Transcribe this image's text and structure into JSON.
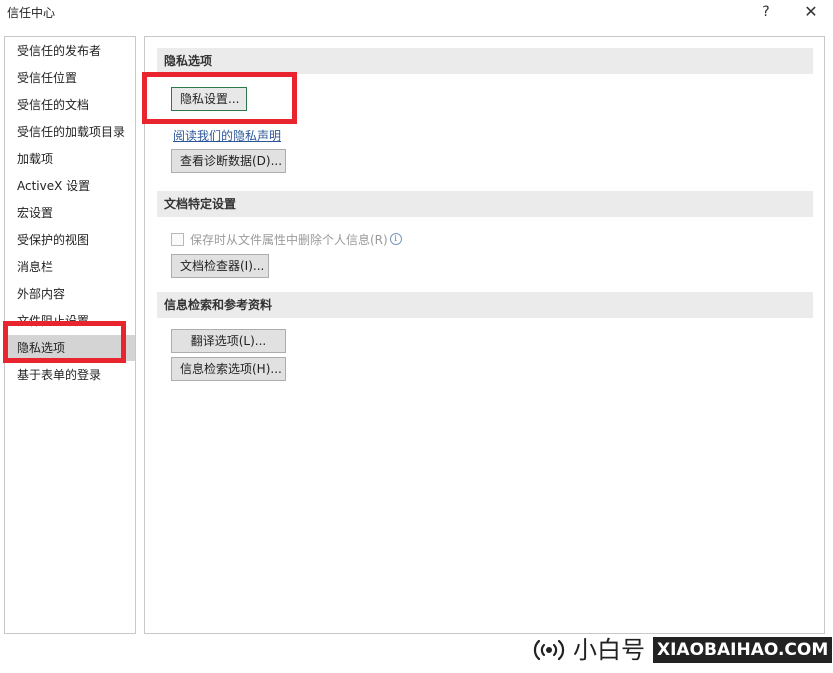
{
  "window": {
    "title": "信任中心",
    "help_glyph": "?",
    "close_glyph": "✕"
  },
  "sidebar": {
    "items": [
      {
        "label": "受信任的发布者",
        "selected": false
      },
      {
        "label": "受信任位置",
        "selected": false
      },
      {
        "label": "受信任的文档",
        "selected": false
      },
      {
        "label": "受信任的加载项目录",
        "selected": false
      },
      {
        "label": "加载项",
        "selected": false
      },
      {
        "label": "ActiveX 设置",
        "selected": false
      },
      {
        "label": "宏设置",
        "selected": false
      },
      {
        "label": "受保护的视图",
        "selected": false
      },
      {
        "label": "消息栏",
        "selected": false
      },
      {
        "label": "外部内容",
        "selected": false
      },
      {
        "label": "文件阻止设置",
        "selected": false
      },
      {
        "label": "隐私选项",
        "selected": true
      },
      {
        "label": "基于表单的登录",
        "selected": false
      }
    ]
  },
  "main": {
    "privacy": {
      "header": "隐私选项",
      "settings_button": "隐私设置...",
      "privacy_link": "阅读我们的隐私声明",
      "diagnostics_button": "查看诊断数据(D)..."
    },
    "document": {
      "header": "文档特定设置",
      "remove_info_checkbox": "保存时从文件属性中删除个人信息(R)",
      "remove_info_checked": false,
      "inspector_button": "文档检查器(I)..."
    },
    "research": {
      "header": "信息检索和参考资料",
      "translate_button": "翻译选项(L)...",
      "research_button": "信息检索选项(H)..."
    }
  },
  "brand": {
    "name_cn": "小白号",
    "name_en": "XIAOBAIHAO.COM"
  },
  "colors": {
    "highlight": "#e8242f",
    "selected_bg": "#d4d4d4",
    "link": "#2b579a"
  }
}
